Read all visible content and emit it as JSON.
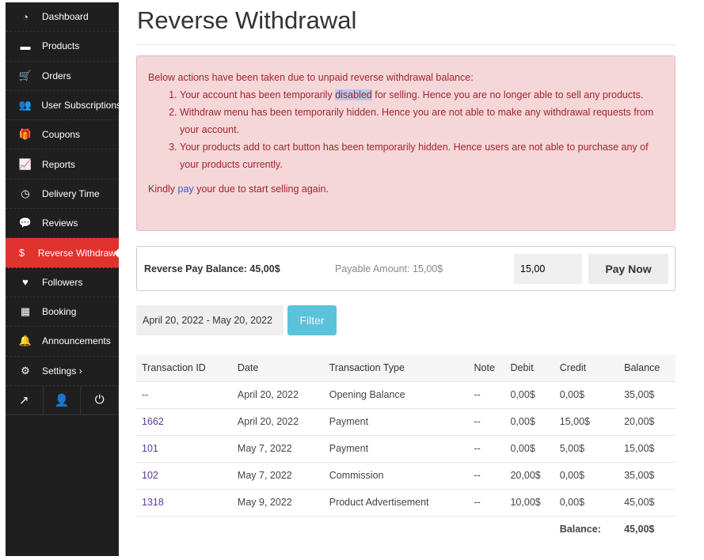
{
  "sidebar": {
    "items": [
      {
        "label": "Dashboard",
        "icon": "dashboard-icon",
        "glyph": "◔"
      },
      {
        "label": "Products",
        "icon": "briefcase-icon",
        "glyph": "▬"
      },
      {
        "label": "Orders",
        "icon": "cart-icon",
        "glyph": "🛒"
      },
      {
        "label": "User Subscriptions",
        "icon": "users-icon",
        "glyph": "👥"
      },
      {
        "label": "Coupons",
        "icon": "gift-icon",
        "glyph": "🎁"
      },
      {
        "label": "Reports",
        "icon": "chart-icon",
        "glyph": "📈"
      },
      {
        "label": "Delivery Time",
        "icon": "clock-icon",
        "glyph": "◷"
      },
      {
        "label": "Reviews",
        "icon": "comments-icon",
        "glyph": "💬"
      },
      {
        "label": "Reverse Withdrawal",
        "icon": "dollar-icon",
        "glyph": "$"
      },
      {
        "label": "Followers",
        "icon": "heart-icon",
        "glyph": "♥"
      },
      {
        "label": "Booking",
        "icon": "calendar-icon",
        "glyph": "▦"
      },
      {
        "label": "Announcements",
        "icon": "bell-icon",
        "glyph": "🔔"
      },
      {
        "label": "Settings ›",
        "icon": "gear-icon",
        "glyph": "⚙"
      }
    ],
    "bottom": [
      {
        "icon": "external-link-icon",
        "glyph": "↗"
      },
      {
        "icon": "user-icon",
        "glyph": "👤"
      },
      {
        "icon": "power-icon",
        "glyph": "⏻"
      }
    ],
    "active_color": "#e0332e"
  },
  "page": {
    "title": "Reverse Withdrawal"
  },
  "alert": {
    "intro": "Below actions have been taken due to unpaid reverse withdrawal balance:",
    "item1_a": "Your account has been temporarily ",
    "item1_hl": "disabled",
    "item1_b": " for selling. Hence you are no longer able to sell any products.",
    "item2": "Withdraw menu has been temporarily hidden. Hence you are not able to make any withdrawal requests from your account.",
    "item3": "Your products add to cart button has been temporarily hidden. Hence users are not able to purchase any of your products currently.",
    "outro_a": "Kindly ",
    "outro_link": "pay",
    "outro_b": " your due to start selling again."
  },
  "pay": {
    "balance": "Reverse Pay Balance: 45,00$",
    "payable": "Payable Amount: 15,00$",
    "amount_value": "15,00",
    "button": "Pay Now"
  },
  "filter": {
    "date_range": "April 20, 2022 - May 20, 2022",
    "button": "Filter"
  },
  "table": {
    "headers": [
      "Transaction ID",
      "Date",
      "Transaction Type",
      "Note",
      "Debit",
      "Credit",
      "Balance"
    ],
    "rows": [
      [
        "--",
        "April 20, 2022",
        "Opening Balance",
        "--",
        "0,00$",
        "0,00$",
        "35,00$"
      ],
      [
        "1662",
        "April 20, 2022",
        "Payment",
        "--",
        "0,00$",
        "15,00$",
        "20,00$"
      ],
      [
        "101",
        "May 7, 2022",
        "Payment",
        "--",
        "0,00$",
        "5,00$",
        "15,00$"
      ],
      [
        "102",
        "May 7, 2022",
        "Commission",
        "--",
        "20,00$",
        "0,00$",
        "35,00$"
      ],
      [
        "1318",
        "May 9, 2022",
        "Product Advertisement",
        "--",
        "10,00$",
        "0,00$",
        "45,00$"
      ]
    ],
    "footer_label": "Balance:",
    "footer_value": "45,00$"
  }
}
